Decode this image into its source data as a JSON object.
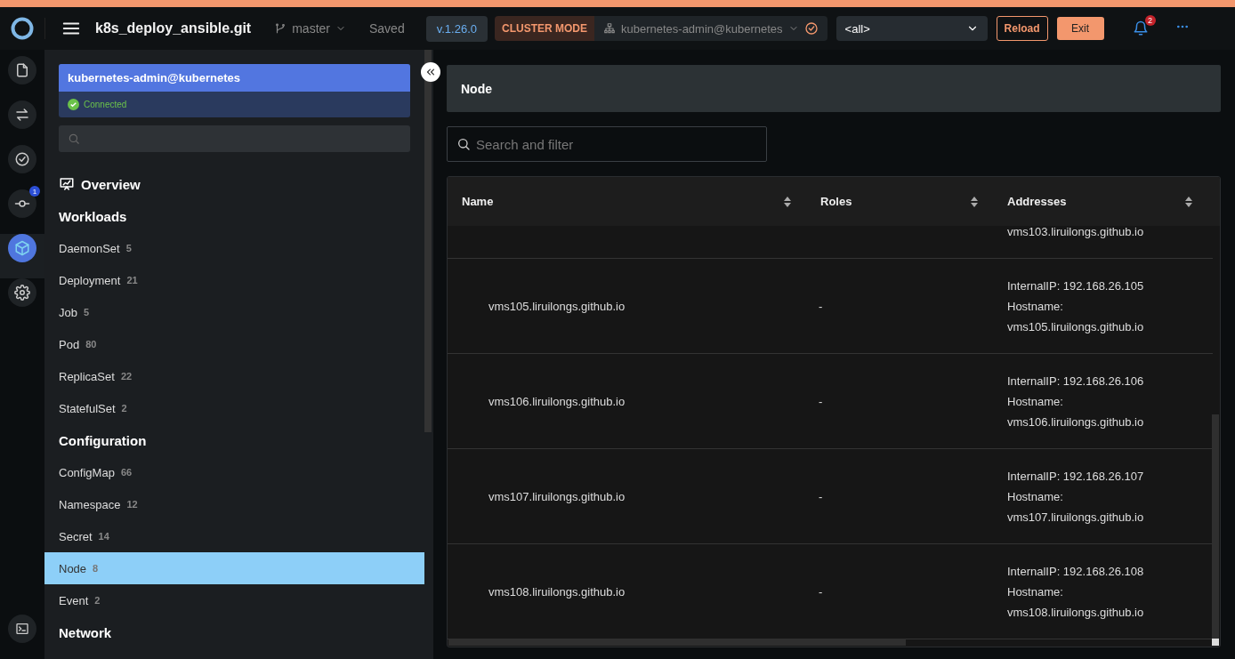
{
  "top_bar": {
    "repository": "k8s_deploy_ansible.git",
    "branch": "master",
    "save_status": "Saved",
    "version": "v.1.26.0",
    "mode_badge": "CLUSTER MODE",
    "context": "kubernetes-admin@kubernetes",
    "namespace": "<all>",
    "buttons": [
      "Reload",
      "Exit"
    ],
    "notifications": "2"
  },
  "rail": [
    {
      "kind": "file",
      "selected": false
    },
    {
      "kind": "swap",
      "selected": false
    },
    {
      "kind": "check",
      "selected": false
    },
    {
      "kind": "commit",
      "selected": false,
      "badge": "1"
    },
    {
      "kind": "cube",
      "selected": true
    },
    {
      "kind": "gear",
      "selected": false
    },
    {
      "kind": "terminal",
      "selected": false
    }
  ],
  "sidebar": {
    "cluster": "kubernetes-admin@kubernetes",
    "status": "Connected",
    "items": [
      {
        "kind": "link",
        "label": "Overview"
      },
      {
        "kind": "heading",
        "label": "Workloads"
      },
      {
        "kind": "item",
        "label": "DaemonSet",
        "count": "5",
        "selected": false
      },
      {
        "kind": "item",
        "label": "Deployment",
        "count": "21",
        "selected": false
      },
      {
        "kind": "item",
        "label": "Job",
        "count": "5",
        "selected": false
      },
      {
        "kind": "item",
        "label": "Pod",
        "count": "80",
        "selected": false
      },
      {
        "kind": "item",
        "label": "ReplicaSet",
        "count": "22",
        "selected": false
      },
      {
        "kind": "item",
        "label": "StatefulSet",
        "count": "2",
        "selected": false
      },
      {
        "kind": "heading",
        "label": "Configuration"
      },
      {
        "kind": "item",
        "label": "ConfigMap",
        "count": "66",
        "selected": false
      },
      {
        "kind": "item",
        "label": "Namespace",
        "count": "12",
        "selected": false
      },
      {
        "kind": "item",
        "label": "Secret",
        "count": "14",
        "selected": false
      },
      {
        "kind": "item",
        "label": "Node",
        "count": "8",
        "selected": true
      },
      {
        "kind": "item",
        "label": "Event",
        "count": "2",
        "selected": false
      },
      {
        "kind": "heading",
        "label": "Network"
      }
    ]
  },
  "main": {
    "title": "Node",
    "search": {
      "placeholder": "Search and filter"
    },
    "table": {
      "columns": [
        "Name",
        "Roles",
        "Addresses"
      ],
      "rows": [
        {
          "addresses": [
            "vms103.liruilongs.github.io"
          ]
        },
        {
          "name": "vms105.liruilongs.github.io",
          "roles": "-",
          "addresses": [
            "InternalIP: 192.168.26.105",
            "Hostname:",
            "vms105.liruilongs.github.io"
          ]
        },
        {
          "name": "vms106.liruilongs.github.io",
          "roles": "-",
          "addresses": [
            "InternalIP: 192.168.26.106",
            "Hostname:",
            "vms106.liruilongs.github.io"
          ]
        },
        {
          "name": "vms107.liruilongs.github.io",
          "roles": "-",
          "addresses": [
            "InternalIP: 192.168.26.107",
            "Hostname:",
            "vms107.liruilongs.github.io"
          ]
        },
        {
          "name": "vms108.liruilongs.github.io",
          "roles": "-",
          "addresses": [
            "InternalIP: 192.168.26.108",
            "Hostname:",
            "vms108.liruilongs.github.io"
          ]
        }
      ]
    }
  }
}
